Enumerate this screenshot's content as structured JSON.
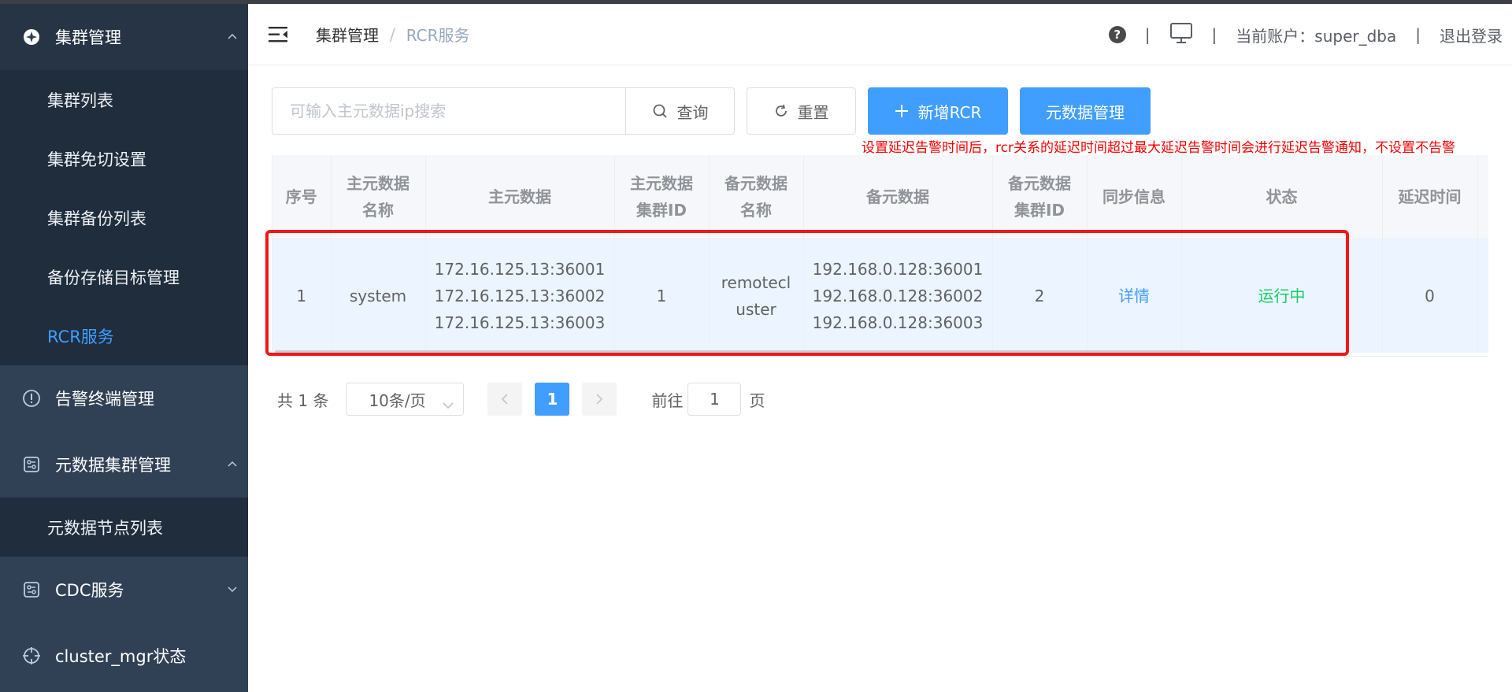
{
  "sidebar": {
    "groups": [
      {
        "label": "集群管理",
        "icon": "cluster-icon",
        "expanded": true
      },
      {
        "label": "告警终端管理",
        "icon": "alert-icon"
      },
      {
        "label": "元数据集群管理",
        "icon": "metadata-icon",
        "expanded": true
      },
      {
        "label": "CDC服务",
        "icon": "cdc-icon",
        "expanded": false
      },
      {
        "label": "cluster_mgr状态",
        "icon": "crosshair-icon"
      }
    ],
    "cluster_items": [
      "集群列表",
      "集群免切设置",
      "集群备份列表",
      "备份存储目标管理",
      "RCR服务"
    ],
    "metadata_items": [
      "元数据节点列表"
    ]
  },
  "header": {
    "breadcrumb": [
      "集群管理",
      "RCR服务"
    ],
    "breadcrumb_separator": "/",
    "account_label": "当前账户：super_dba",
    "logout": "退出登录",
    "divider": "|"
  },
  "toolbar": {
    "search_placeholder": "可输入主元数据ip搜索",
    "query_label": "查询",
    "reset_label": "重置",
    "add_label": "新增RCR",
    "meta_label": "元数据管理",
    "warning": "设置延迟告警时间后，rcr关系的延迟时间超过最大延迟告警时间会进行延迟告警通知，不设置不告警"
  },
  "table": {
    "columns": [
      {
        "line1": "序号",
        "line2": ""
      },
      {
        "line1": "主元数据",
        "line2": "名称"
      },
      {
        "line1": "主元数据",
        "line2": ""
      },
      {
        "line1": "主元数据",
        "line2": "集群ID"
      },
      {
        "line1": "备元数据",
        "line2": "名称"
      },
      {
        "line1": "备元数据",
        "line2": ""
      },
      {
        "line1": "备元数据",
        "line2": "集群ID"
      },
      {
        "line1": "同步信息",
        "line2": ""
      },
      {
        "line1": "状态",
        "line2": ""
      },
      {
        "line1": "延迟时间",
        "line2": ""
      },
      {
        "line1": "",
        "line2": ""
      }
    ],
    "row": {
      "index": "1",
      "master_name": "system",
      "master_ips": [
        "172.16.125.13:36001",
        "172.16.125.13:36002",
        "172.16.125.13:36003"
      ],
      "master_cluster_id": "1",
      "slave_name_lines": [
        "remotecl",
        "uster"
      ],
      "slave_ips": [
        "192.168.0.128:36001",
        "192.168.0.128:36002",
        "192.168.0.128:36003"
      ],
      "slave_cluster_id": "2",
      "sync_info": "详情",
      "status": "运行中",
      "delay": "0"
    }
  },
  "pagination": {
    "total": "共 1 条",
    "page_size": "10条/页",
    "current_page": "1",
    "goto_label": "前往",
    "goto_value": "1",
    "page_suffix": "页"
  },
  "colors": {
    "sidebar_bg": "#304156",
    "submenu_bg": "#1f2d3d",
    "primary": "#409eff",
    "success": "#13ce66",
    "warning_text": "#f50000",
    "highlight_border": "#f21717"
  }
}
